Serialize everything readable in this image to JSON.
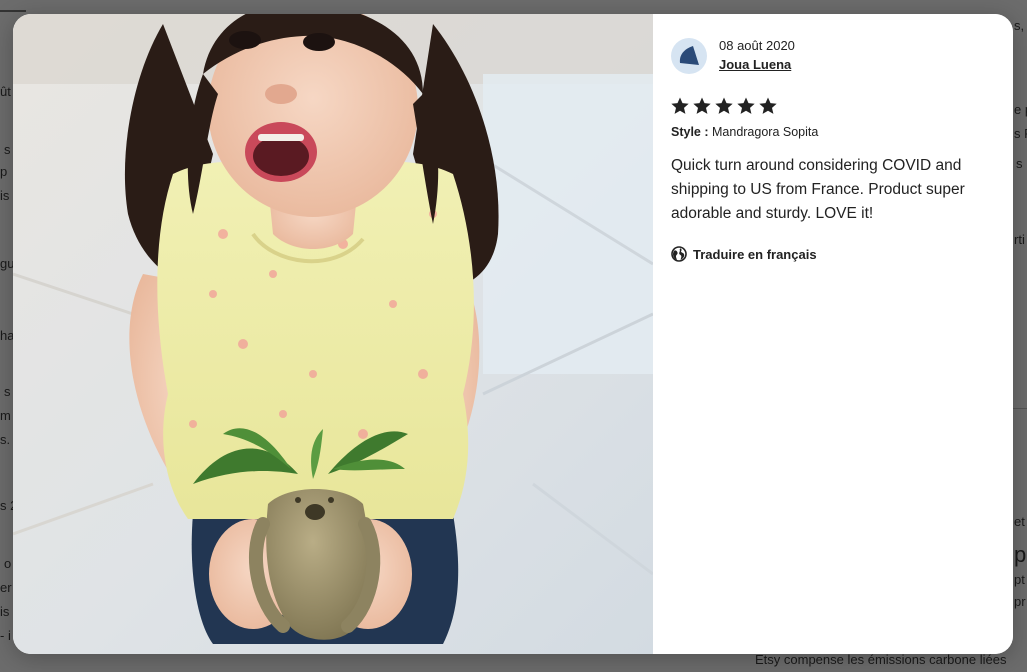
{
  "background": {
    "fragments": [
      "ût",
      "s",
      "p",
      "is",
      "gu",
      "ha",
      "s",
      "m",
      "s. l",
      "s 2",
      "o",
      "er",
      "is",
      "- i",
      "s, l",
      "e p",
      "s F",
      "s",
      "rti",
      "et",
      "p",
      "pt",
      "pr"
    ],
    "footer_text": "Etsy compense les émissions carbone liées"
  },
  "review": {
    "date": "08 août 2020",
    "author": "Joua Luena",
    "rating": 5,
    "style_label": "Style :",
    "style_value": "Mandragora Sopita",
    "text": "Quick turn around considering COVID and shipping to US from France. Product super adorable and sturdy. LOVE it!",
    "translate_label": "Traduire en français"
  },
  "colors": {
    "star": "#222222",
    "avatar_bg": "#d6e4f2",
    "avatar_shape": "#2a4a78"
  },
  "icons": {
    "avatar": "avatar-icon",
    "star": "star-icon",
    "globe": "globe-icon"
  }
}
